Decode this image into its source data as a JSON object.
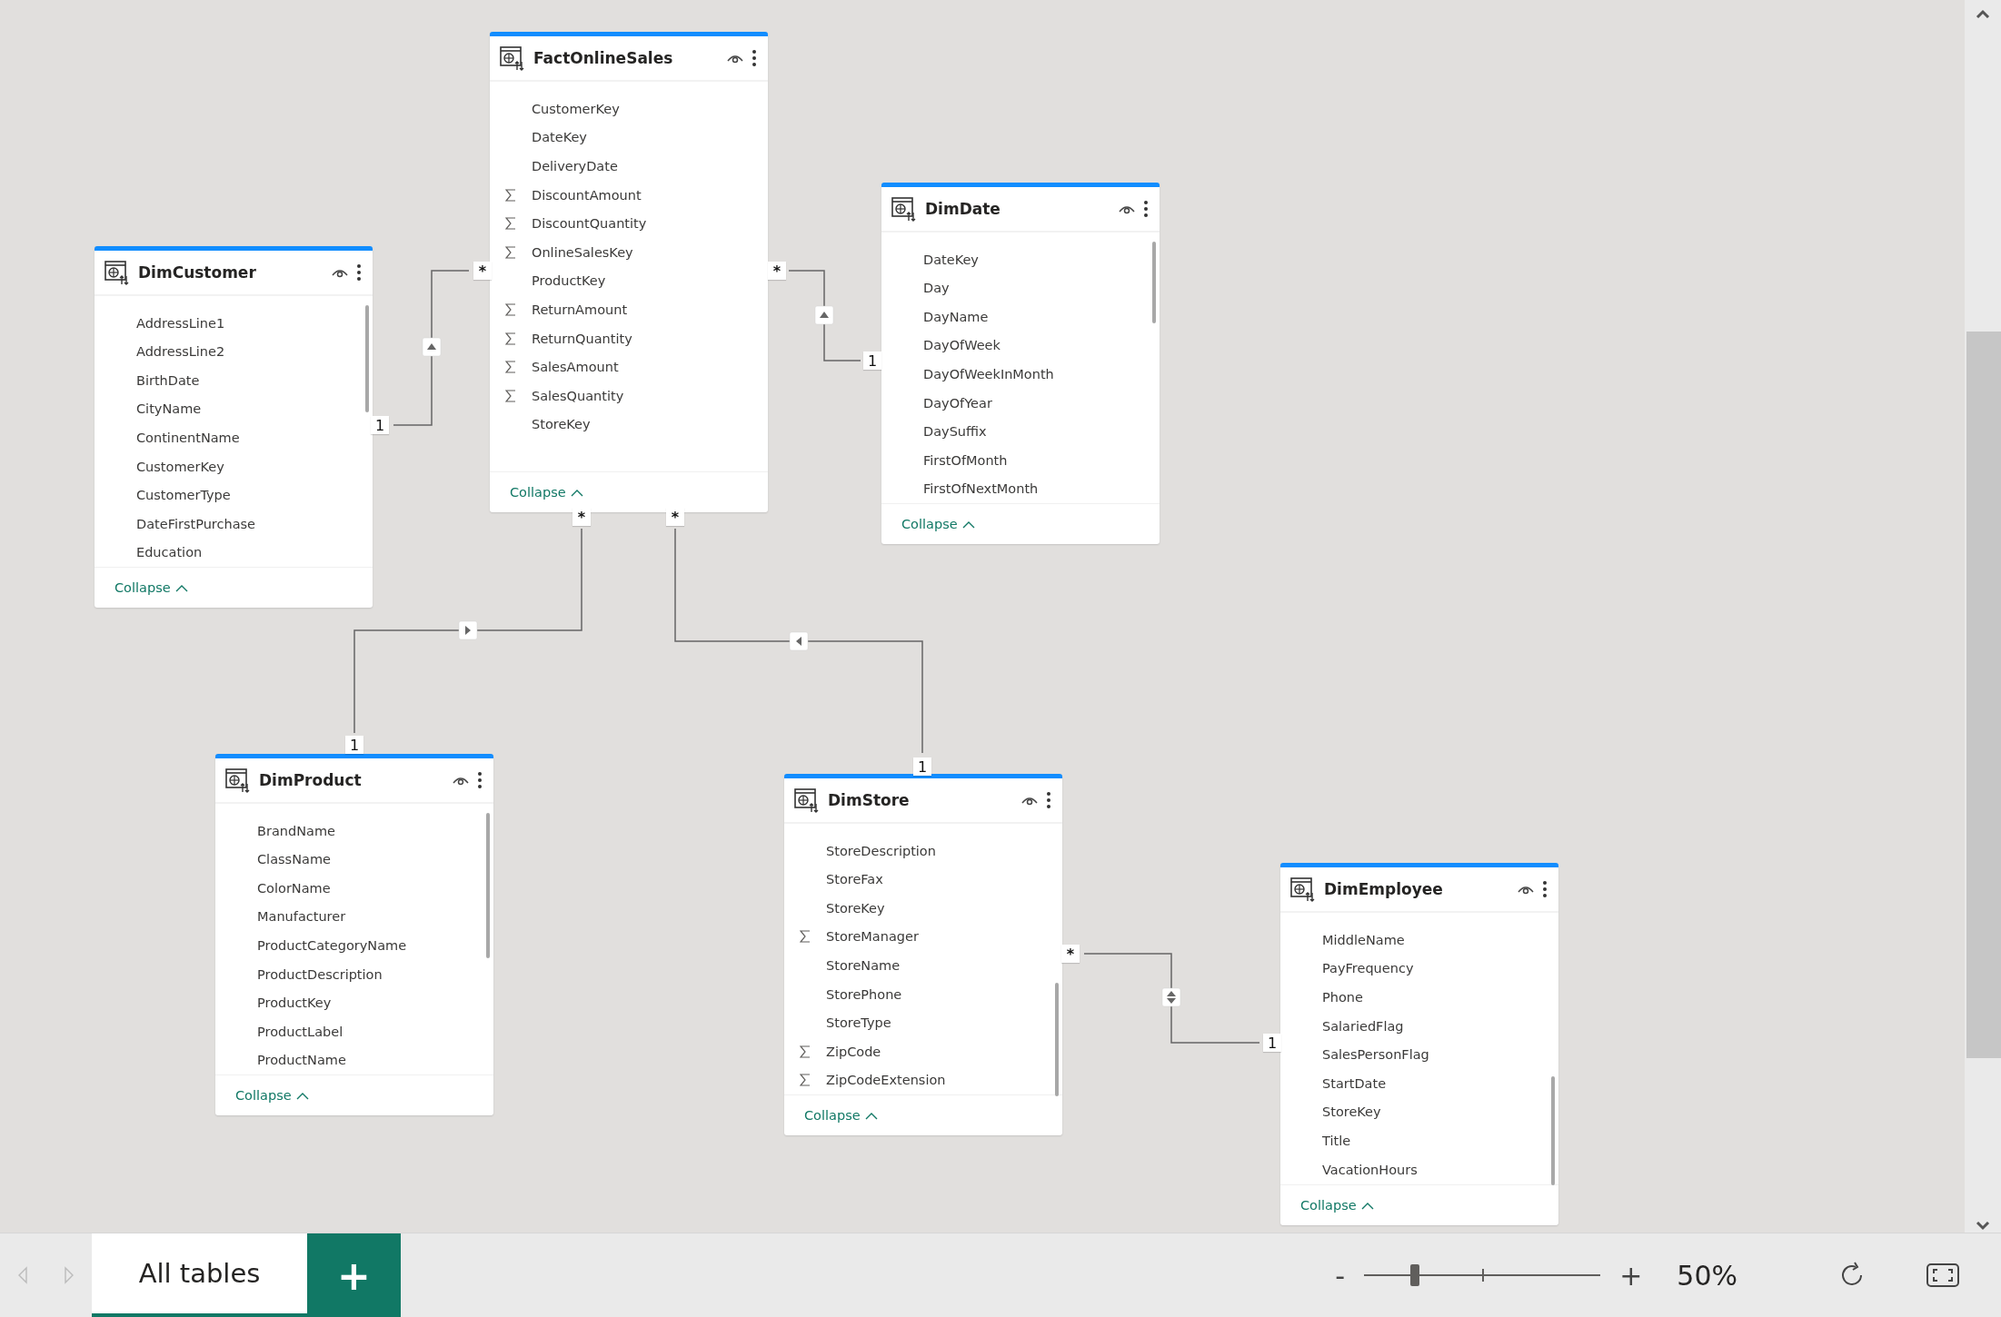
{
  "tables": [
    {
      "name": "FactOnlineSales",
      "fields": [
        {
          "name": "CustomerKey",
          "summarized": false
        },
        {
          "name": "DateKey",
          "summarized": false
        },
        {
          "name": "DeliveryDate",
          "summarized": false
        },
        {
          "name": "DiscountAmount",
          "summarized": true
        },
        {
          "name": "DiscountQuantity",
          "summarized": true
        },
        {
          "name": "OnlineSalesKey",
          "summarized": true
        },
        {
          "name": "ProductKey",
          "summarized": false
        },
        {
          "name": "ReturnAmount",
          "summarized": true
        },
        {
          "name": "ReturnQuantity",
          "summarized": true
        },
        {
          "name": "SalesAmount",
          "summarized": true
        },
        {
          "name": "SalesQuantity",
          "summarized": true
        },
        {
          "name": "StoreKey",
          "summarized": false
        }
      ],
      "footer": "Collapse"
    },
    {
      "name": "DimDate",
      "fields": [
        {
          "name": "DateKey",
          "summarized": false
        },
        {
          "name": "Day",
          "summarized": false
        },
        {
          "name": "DayName",
          "summarized": false
        },
        {
          "name": "DayOfWeek",
          "summarized": false
        },
        {
          "name": "DayOfWeekInMonth",
          "summarized": false
        },
        {
          "name": "DayOfYear",
          "summarized": false
        },
        {
          "name": "DaySuffix",
          "summarized": false
        },
        {
          "name": "FirstOfMonth",
          "summarized": false
        },
        {
          "name": "FirstOfNextMonth",
          "summarized": false
        }
      ],
      "footer": "Collapse"
    },
    {
      "name": "DimCustomer",
      "fields": [
        {
          "name": "AddressLine1",
          "summarized": false
        },
        {
          "name": "AddressLine2",
          "summarized": false
        },
        {
          "name": "BirthDate",
          "summarized": false
        },
        {
          "name": "CityName",
          "summarized": false
        },
        {
          "name": "ContinentName",
          "summarized": false
        },
        {
          "name": "CustomerKey",
          "summarized": false
        },
        {
          "name": "CustomerType",
          "summarized": false
        },
        {
          "name": "DateFirstPurchase",
          "summarized": false
        },
        {
          "name": "Education",
          "summarized": false
        }
      ],
      "footer": "Collapse"
    },
    {
      "name": "DimProduct",
      "fields": [
        {
          "name": "BrandName",
          "summarized": false
        },
        {
          "name": "ClassName",
          "summarized": false
        },
        {
          "name": "ColorName",
          "summarized": false
        },
        {
          "name": "Manufacturer",
          "summarized": false
        },
        {
          "name": "ProductCategoryName",
          "summarized": false
        },
        {
          "name": "ProductDescription",
          "summarized": false
        },
        {
          "name": "ProductKey",
          "summarized": false
        },
        {
          "name": "ProductLabel",
          "summarized": false
        },
        {
          "name": "ProductName",
          "summarized": false
        }
      ],
      "footer": "Collapse"
    },
    {
      "name": "DimStore",
      "fields": [
        {
          "name": "StoreDescription",
          "summarized": false
        },
        {
          "name": "StoreFax",
          "summarized": false
        },
        {
          "name": "StoreKey",
          "summarized": false
        },
        {
          "name": "StoreManager",
          "summarized": true
        },
        {
          "name": "StoreName",
          "summarized": false
        },
        {
          "name": "StorePhone",
          "summarized": false
        },
        {
          "name": "StoreType",
          "summarized": false
        },
        {
          "name": "ZipCode",
          "summarized": true
        },
        {
          "name": "ZipCodeExtension",
          "summarized": true
        }
      ],
      "footer": "Collapse"
    },
    {
      "name": "DimEmployee",
      "fields": [
        {
          "name": "MiddleName",
          "summarized": false
        },
        {
          "name": "PayFrequency",
          "summarized": false
        },
        {
          "name": "Phone",
          "summarized": false
        },
        {
          "name": "SalariedFlag",
          "summarized": false
        },
        {
          "name": "SalesPersonFlag",
          "summarized": false
        },
        {
          "name": "StartDate",
          "summarized": false
        },
        {
          "name": "StoreKey",
          "summarized": false
        },
        {
          "name": "Title",
          "summarized": false
        },
        {
          "name": "VacationHours",
          "summarized": false
        }
      ],
      "footer": "Collapse"
    }
  ],
  "relationships": [
    {
      "many_label": "*",
      "one_label": "1",
      "kind": "single"
    },
    {
      "many_label": "*",
      "one_label": "1",
      "kind": "single"
    },
    {
      "many_label": "*",
      "one_label": "1",
      "kind": "single"
    },
    {
      "many_label": "*",
      "one_label": "1",
      "kind": "single"
    },
    {
      "many_label": "*",
      "one_label": "1",
      "kind": "both"
    }
  ],
  "bottom_bar": {
    "tabs": [
      {
        "label": "All tables",
        "selected": true
      }
    ],
    "add_button": "+",
    "zoom": {
      "minus": "-",
      "plus": "+",
      "level": 0.22,
      "reading": "50%"
    }
  }
}
